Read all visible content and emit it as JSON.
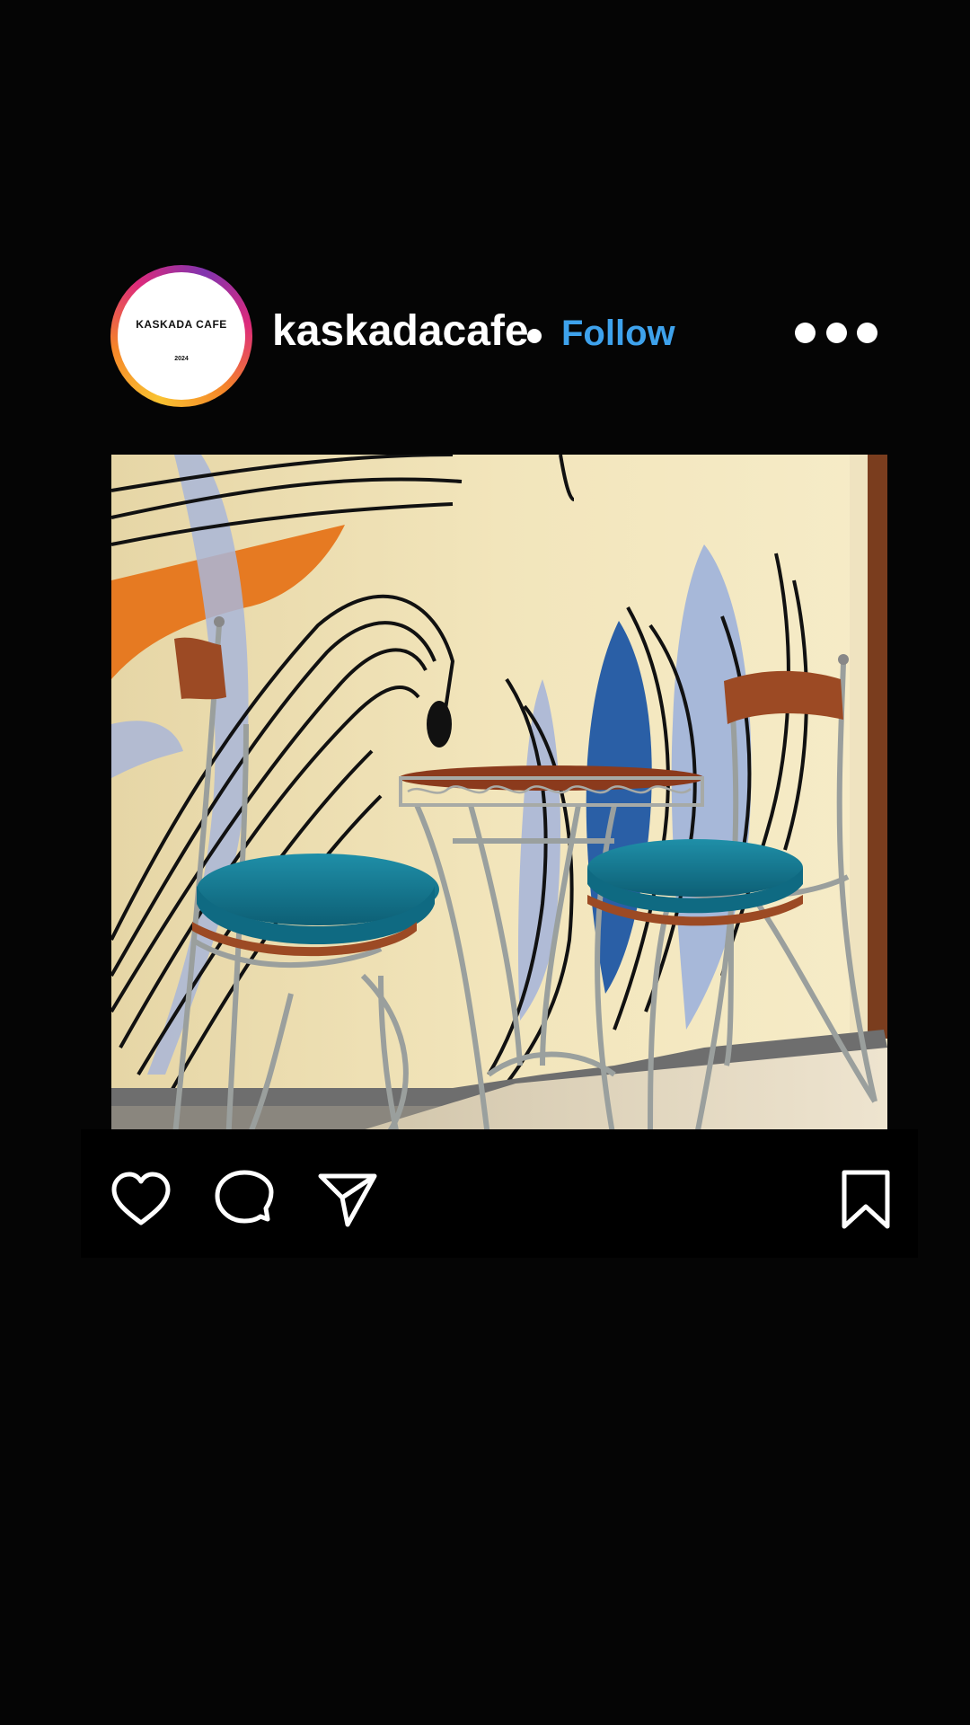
{
  "post": {
    "account": {
      "username": "kaskadacafe",
      "avatar_text": "KASKADA CAFE",
      "avatar_year": "2024",
      "follow_label": "Follow"
    },
    "menu": {
      "icon": "more-horizontal-icon"
    },
    "image": {
      "alt": "Mural wall with two cafe chairs with teal cushions and a round metal table"
    },
    "actions": {
      "like_icon": "heart-icon",
      "comment_icon": "comment-icon",
      "share_icon": "send-icon",
      "save_icon": "bookmark-icon"
    }
  },
  "colors": {
    "background": "#050505",
    "follow": "#3ea2ec",
    "text": "#ffffff"
  }
}
